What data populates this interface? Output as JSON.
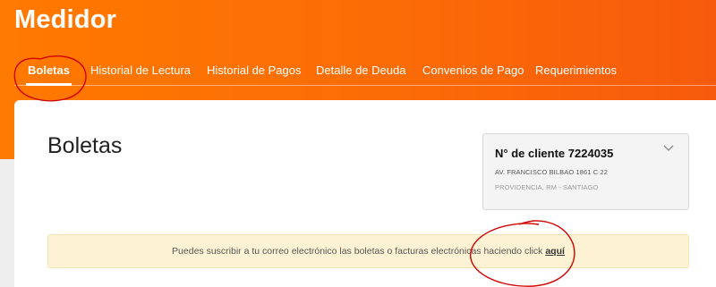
{
  "app": {
    "title": "Medidor"
  },
  "tabs": [
    {
      "label": "Boletas",
      "active": true
    },
    {
      "label": "Historial de Lectura"
    },
    {
      "label": "Historial de Pagos"
    },
    {
      "label": "Detalle de Deuda"
    },
    {
      "label": "Convenios de Pago"
    },
    {
      "label": "Requerimientos"
    }
  ],
  "main": {
    "title": "Boletas"
  },
  "client": {
    "number_label": "N° de cliente 7224035",
    "address": "AV. FRANCISCO BILBAO 1861 C 22",
    "commune": "PROVIDENCIA, RM - SANTIAGO",
    "toggle_icon": "chevron-down-icon"
  },
  "notice": {
    "text": "Puedes suscribir a tu correo electrónico las boletas o facturas electrónicas haciendo click ",
    "link_label": "aquí"
  },
  "colors": {
    "brand_orange": "#ff7a00",
    "annotation_red": "#d10000",
    "notice_bg": "#fdf3d4"
  }
}
